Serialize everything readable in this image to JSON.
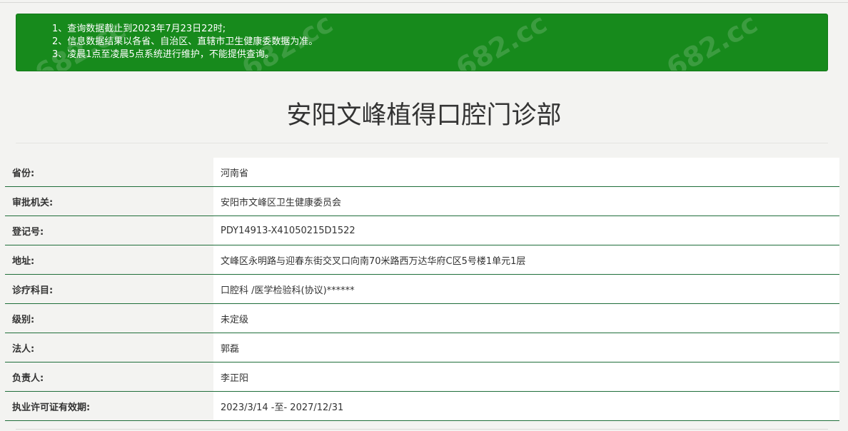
{
  "notice": {
    "items": [
      "1、查询数据截止到2023年7月23日22时;",
      "2、信息数据结果以各省、自治区、直辖市卫生健康委数据为准。",
      "3、凌晨1点至凌晨5点系统进行维护，不能提供查询。"
    ],
    "watermark": "682.cc",
    "background_color": "#178a1c"
  },
  "page": {
    "title": "安阳文峰植得口腔门诊部"
  },
  "details": {
    "rows": [
      {
        "label": "省份:",
        "value": "河南省"
      },
      {
        "label": "审批机关:",
        "value": "安阳市文峰区卫生健康委员会"
      },
      {
        "label": "登记号:",
        "value": "PDY14913-X41050215D1522"
      },
      {
        "label": "地址:",
        "value": "文峰区永明路与迎春东街交叉口向南70米路西万达华府C区5号楼1单元1层"
      },
      {
        "label": "诊疗科目:",
        "value": "口腔科 /医学检验科(协议)******"
      },
      {
        "label": "级别:",
        "value": "未定级"
      },
      {
        "label": "法人:",
        "value": "郭磊"
      },
      {
        "label": "负责人:",
        "value": "李正阳"
      },
      {
        "label": "执业许可证有效期:",
        "value": "2023/3/14 -至- 2027/12/31"
      }
    ],
    "border_color": "#1f6e3a"
  }
}
